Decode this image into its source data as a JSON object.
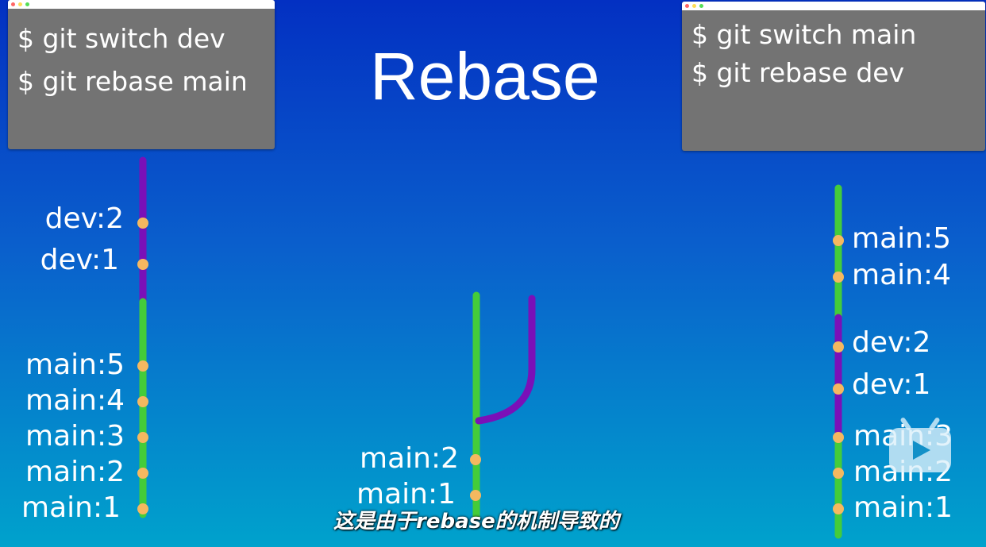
{
  "title": "Rebase",
  "left_terminal": {
    "lines": [
      "$ git switch dev",
      "$ git rebase main"
    ]
  },
  "right_terminal": {
    "lines": [
      "$ git switch main",
      "$ git rebase dev"
    ]
  },
  "left_graph": {
    "commits": [
      "dev:2",
      "dev:1",
      "main:5",
      "main:4",
      "main:3",
      "main:2",
      "main:1"
    ]
  },
  "middle_graph": {
    "commits": [
      "main:2",
      "main:1"
    ]
  },
  "right_graph": {
    "commits": [
      "main:5",
      "main:4",
      "dev:2",
      "dev:1",
      "main:3",
      "main:2",
      "main:1"
    ]
  },
  "subtitle": "这是由于rebase的机制导致的",
  "colors": {
    "main": "#44cc3a",
    "dev": "#7a10b8",
    "commit": "#f5b860",
    "terminal": "#737373"
  }
}
